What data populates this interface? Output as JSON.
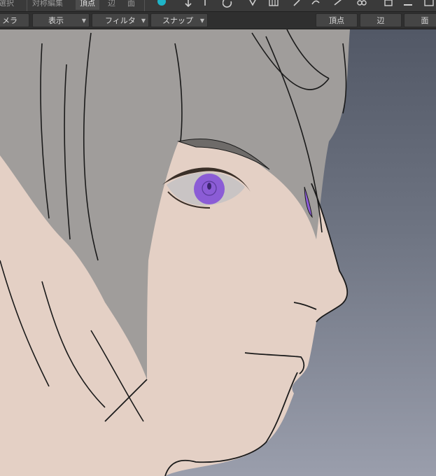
{
  "toolbar_top": {
    "tabs": [
      "選択",
      "対称編集",
      "頂点",
      "辺",
      "面"
    ],
    "selected_tab": "頂点"
  },
  "toolbar_second": {
    "menus": [
      "メラ",
      "表示",
      "フィルタ",
      "スナップ"
    ],
    "mode_buttons": [
      "頂点",
      "辺",
      "面"
    ]
  },
  "colors": {
    "skin": "#e4d0c5",
    "hair": "#a09d9b",
    "iris": "#8b5cd6",
    "sclera": "#c9c4c4",
    "line": "#1a1a1a",
    "background_top": "#525866",
    "background_bottom": "#9a9eac"
  },
  "viewport": {
    "content": "3d-model-anime-character-side-profile"
  }
}
